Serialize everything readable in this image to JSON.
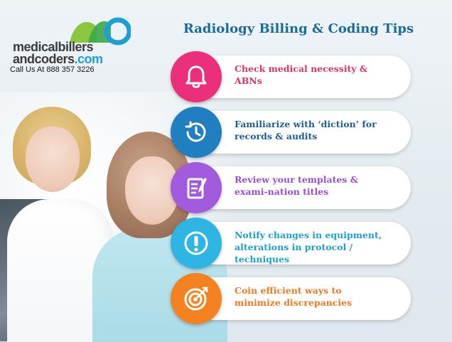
{
  "brand": {
    "line1": "medicalbillers",
    "line2_prefix": "andcoders",
    "line2_suffix": ".com",
    "call": "Call Us At 888 357 3226",
    "colors": {
      "green": "#8cc63f",
      "blue": "#1d9fd6",
      "dark": "#3a3a3a"
    }
  },
  "title": "Radiology Billing & Coding Tips",
  "tips": [
    {
      "text": "Check medical necessity & ABNs",
      "icon": "bell-icon",
      "color": "#ec2f7a",
      "textColor": "#e0306f"
    },
    {
      "text": "Familiarize with ‘diction’ for records & audits",
      "icon": "clock-icon",
      "color": "#1f7fc0",
      "textColor": "#1a5f93"
    },
    {
      "text": "Review your templates & exami-nation titles",
      "icon": "notepad-icon",
      "color": "#a25bdc",
      "textColor": "#9a4fd3"
    },
    {
      "text": "Notify changes in equipment, alterations in protocol / techniques",
      "icon": "exclamation-icon",
      "color": "#2fb5e3",
      "textColor": "#1b9fcf"
    },
    {
      "text": "Coin efficient ways to minimize discrepancies",
      "icon": "target-icon",
      "color": "#f58220",
      "textColor": "#ee7a1f"
    }
  ]
}
